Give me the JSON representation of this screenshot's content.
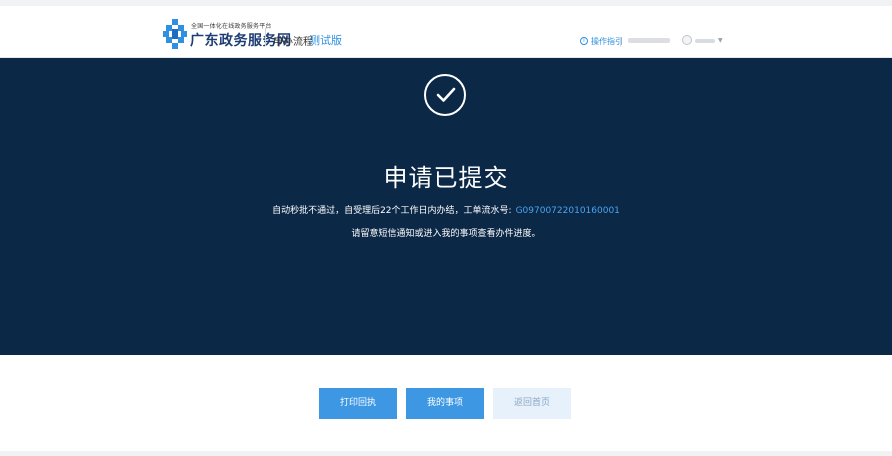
{
  "header": {
    "brand_sub": "全国一体化在线政务服务平台",
    "brand_main": "广东政务服务网",
    "flow_label": "申办流程",
    "test_label": "测试版",
    "guide_label": "操作指引",
    "icons": {
      "logo": "guangdong-gov-logo",
      "guide": "guide-circle-icon",
      "user": "user-avatar-icon",
      "caret": "chevron-down-icon"
    }
  },
  "banner": {
    "title": "申请已提交",
    "message_prefix": "自动秒批不通过，自受理后22个工作日内办结，工单流水号:",
    "serial_number": "G09700722010160001",
    "message_secondary": "请留意短信通知或进入我的事项查看办件进度。",
    "icon": "check-circle-icon"
  },
  "actions": {
    "print_label": "打印回执",
    "my_items_label": "我的事项",
    "home_label": "返回首页"
  },
  "colors": {
    "banner_bg": "#0c2847",
    "primary_button": "#3e97e3",
    "secondary_button": "#e7f1fb",
    "link_blue": "#4aa3f0",
    "brand_blue": "#1e3d73"
  }
}
